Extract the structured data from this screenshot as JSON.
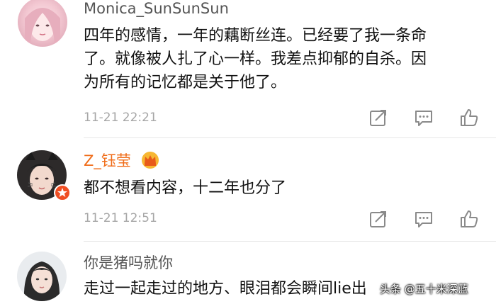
{
  "comments": [
    {
      "username": "Monica_SunSunSun",
      "lines": [
        "四年的感情，一年的藕断丝连。已经要了我一条命",
        "了。就像被人扎了心一样。我差点抑郁的自杀。因",
        "为所有的记忆都是关于他了。"
      ],
      "time": "11-21 22:21",
      "avatar": "avatar-girl-pink"
    },
    {
      "username": "Z_钰莹",
      "lines": [
        "都不想看内容，十二年也分了"
      ],
      "time": "11-21 12:51",
      "avatar": "avatar-girl-cat-ears",
      "badges": [
        "crown-icon",
        "verified-badge-icon"
      ]
    },
    {
      "username": "你是猪吗就你",
      "lines": [
        "走过一起走过的地方、眼泪都会瞬间lie出"
      ],
      "avatar": "avatar-girl-dark-hair"
    }
  ],
  "actions": [
    "share-icon",
    "comment-icon",
    "like-icon"
  ],
  "watermark": "头条 @五十米深蓝",
  "colors": {
    "username": "#555555",
    "highlight_username": "#f06d1a",
    "time": "#a6a6a6",
    "divider": "#e6e6e6"
  }
}
